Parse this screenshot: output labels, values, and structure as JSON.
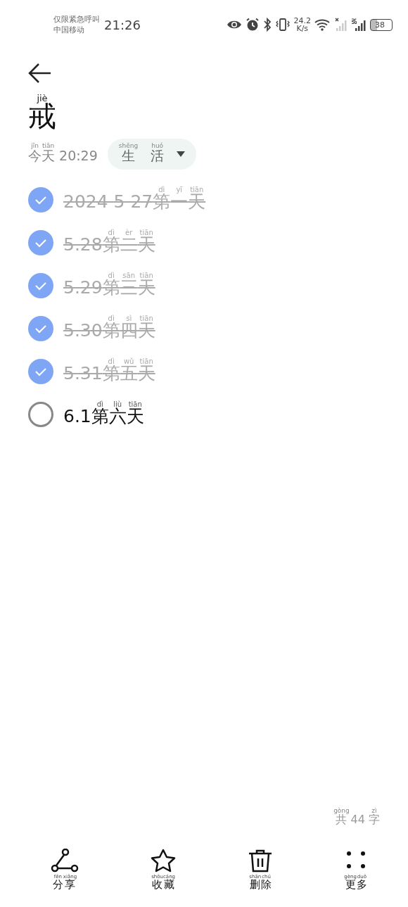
{
  "status_bar": {
    "carrier_lines": [
      "仅限紧急呼叫",
      "中国移动"
    ],
    "time": "21:26",
    "net_speed": [
      "24.2",
      "K/s"
    ],
    "battery": "38"
  },
  "note": {
    "title": [
      {
        "t": "戒",
        "py": "jiè"
      }
    ],
    "date": [
      {
        "t": "今",
        "py": "jīn"
      },
      {
        "t": "天",
        "py": "tiān"
      },
      {
        "t": " 20:29"
      }
    ],
    "category": [
      {
        "t": "生",
        "py": "shēng"
      },
      {
        "t": "活",
        "py": "huó"
      }
    ],
    "items": [
      {
        "done": true,
        "segments": [
          {
            "t": "2024 5 27"
          },
          {
            "t": "第",
            "py": "dì"
          },
          {
            "t": "一",
            "py": "yī"
          },
          {
            "t": "天",
            "py": "tiān"
          }
        ]
      },
      {
        "done": true,
        "segments": [
          {
            "t": "5.28"
          },
          {
            "t": "第",
            "py": "dì"
          },
          {
            "t": "二",
            "py": "èr"
          },
          {
            "t": "天",
            "py": "tiān"
          }
        ]
      },
      {
        "done": true,
        "segments": [
          {
            "t": "5.29"
          },
          {
            "t": "第",
            "py": "dì"
          },
          {
            "t": "三",
            "py": "sān"
          },
          {
            "t": "天",
            "py": "tiān"
          }
        ]
      },
      {
        "done": true,
        "segments": [
          {
            "t": "5.30"
          },
          {
            "t": "第",
            "py": "dì"
          },
          {
            "t": "四",
            "py": "sì"
          },
          {
            "t": "天",
            "py": "tiān"
          }
        ]
      },
      {
        "done": true,
        "segments": [
          {
            "t": "5.31"
          },
          {
            "t": "第",
            "py": "dì"
          },
          {
            "t": "五",
            "py": "wǔ"
          },
          {
            "t": "天",
            "py": "tiān"
          }
        ]
      },
      {
        "done": false,
        "segments": [
          {
            "t": "6.1"
          },
          {
            "t": "第",
            "py": "dì"
          },
          {
            "t": "六",
            "py": "liù"
          },
          {
            "t": "天",
            "py": "tiān"
          }
        ]
      }
    ],
    "word_count": [
      {
        "t": "共",
        "py": "gòng"
      },
      {
        "t": " 44 "
      },
      {
        "t": "字",
        "py": "zì"
      }
    ]
  },
  "toolbar": [
    {
      "kind": "share",
      "label": [
        {
          "t": "分",
          "py": "fēn"
        },
        {
          "t": "享",
          "py": "xiǎng"
        }
      ]
    },
    {
      "kind": "favorite",
      "label": [
        {
          "t": "收",
          "py": "shōu"
        },
        {
          "t": "藏",
          "py": "cáng"
        }
      ]
    },
    {
      "kind": "delete",
      "label": [
        {
          "t": "删",
          "py": "shān"
        },
        {
          "t": "除",
          "py": "chú"
        }
      ]
    },
    {
      "kind": "more",
      "label": [
        {
          "t": "更",
          "py": "gèng"
        },
        {
          "t": "多",
          "py": "duō"
        }
      ]
    }
  ]
}
